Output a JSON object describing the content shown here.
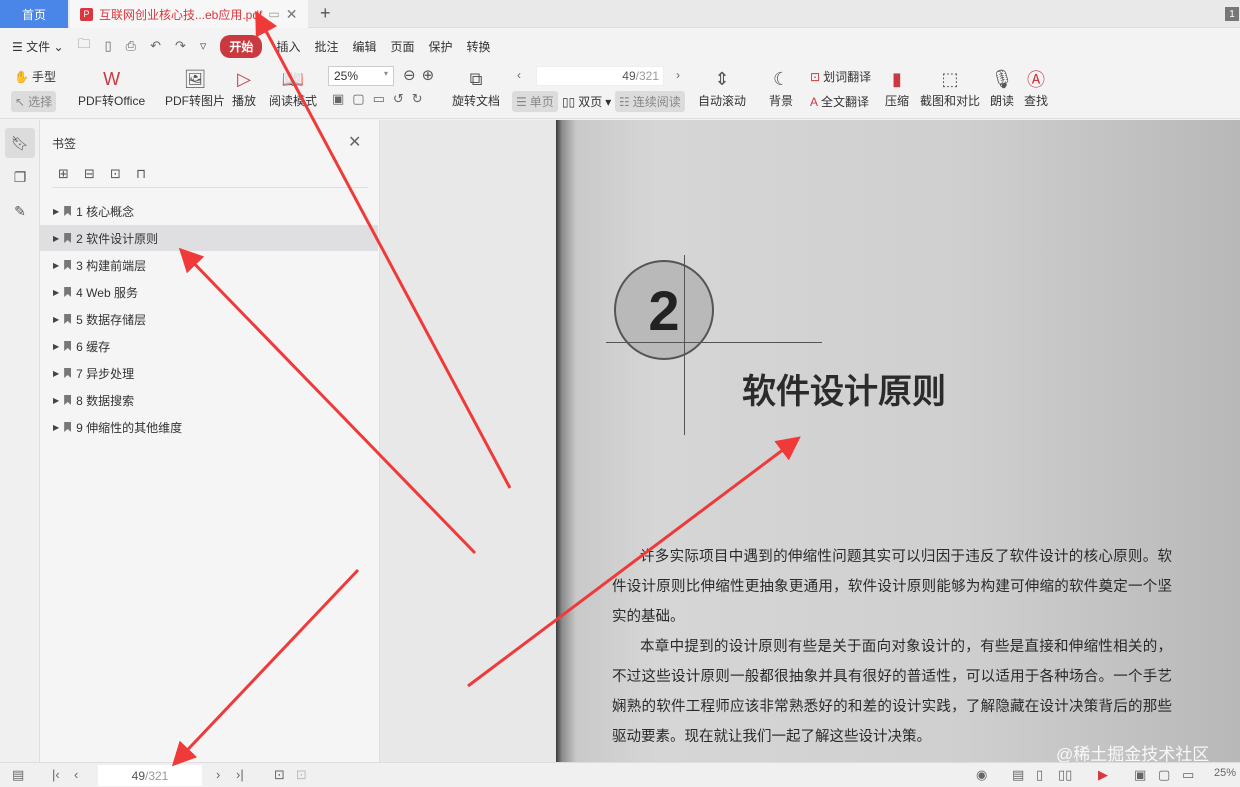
{
  "tabs": {
    "home": "首页",
    "document": "互联网创业核心技...eb应用.pdf",
    "window_count": "1"
  },
  "menu": {
    "file": "文件",
    "items": [
      "开始",
      "插入",
      "批注",
      "编辑",
      "页面",
      "保护",
      "转换"
    ]
  },
  "ribbon": {
    "hand": "手型",
    "select": "选择",
    "pdf_to_office": "PDF转Office",
    "pdf_to_image": "PDF转图片",
    "play": "播放",
    "read_mode": "阅读模式",
    "zoom": "25%",
    "rotate": "旋转文档",
    "page_current": "49",
    "page_total": "/321",
    "single": "单页",
    "double": "双页",
    "continuous": "连续阅读",
    "auto_scroll": "自动滚动",
    "background": "背景",
    "word_translate": "划词翻译",
    "full_translate": "全文翻译",
    "compress": "压缩",
    "screenshot": "截图和对比",
    "read_aloud": "朗读",
    "find": "查找"
  },
  "bookmarks": {
    "title": "书签",
    "items": [
      "1 核心概念",
      "2 软件设计原则",
      "3 构建前端层",
      "4 Web 服务",
      "5 数据存储层",
      "6 缓存",
      "7 异步处理",
      "8 数据搜索",
      "9 伸缩性的其他维度"
    ],
    "active_index": 1
  },
  "page": {
    "chapter_number": "2",
    "chapter_title": "软件设计原则",
    "paragraphs": [
      "许多实际项目中遇到的伸缩性问题其实可以归因于违反了软件设计的核心原则。软件设计原则比伸缩性更抽象更通用，软件设计原则能够为构建可伸缩的软件奠定一个坚实的基础。",
      "本章中提到的设计原则有些是关于面向对象设计的，有些是直接和伸缩性相关的，不过这些设计原则一般都很抽象并具有很好的普适性，可以适用于各种场合。一个手艺娴熟的软件工程师应该非常熟悉好的和差的设计实践，了解隐藏在设计决策背后的那些驱动要素。现在就让我们一起了解这些设计决策。"
    ],
    "watermark": "@稀土掘金技术社区"
  },
  "status": {
    "page_current": "49",
    "page_total": "/321",
    "zoom": "25%"
  },
  "colors": {
    "accent": "#c9393f",
    "home_tab": "#4a86e8",
    "arrow": "#f03a3a"
  }
}
